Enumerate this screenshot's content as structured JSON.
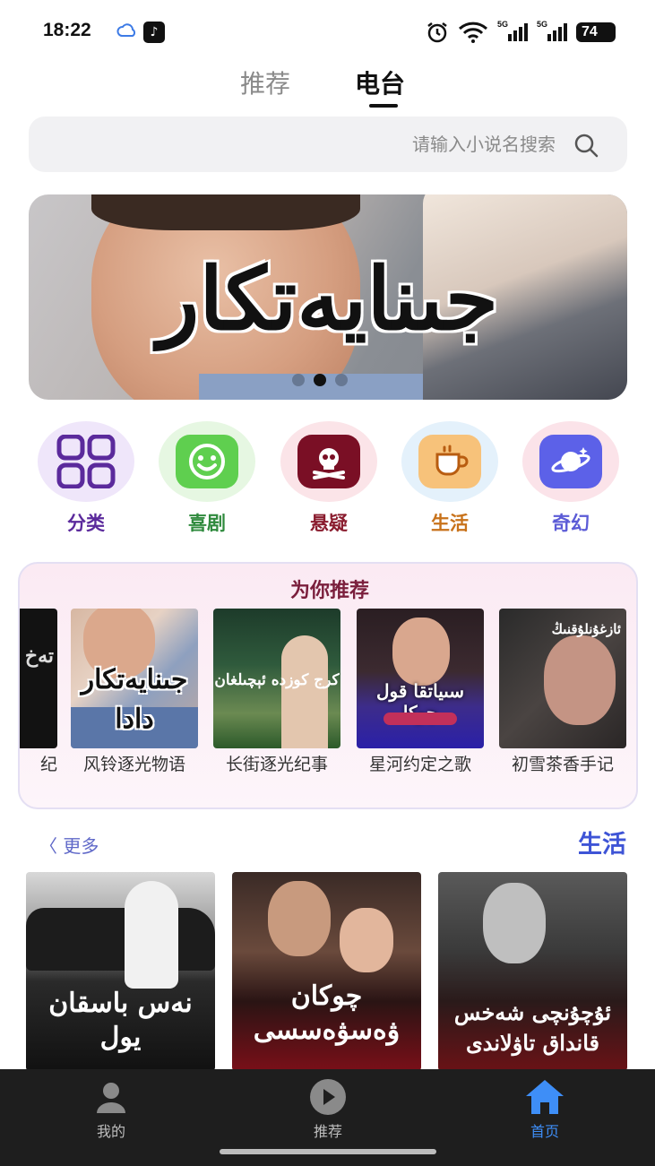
{
  "status_bar": {
    "time": "18:22",
    "battery": "74",
    "signal1": "5G",
    "signal2": "5G"
  },
  "tabs": [
    {
      "label": "推荐",
      "active": false
    },
    {
      "label": "电台",
      "active": true
    }
  ],
  "search": {
    "placeholder": "请输入小说名搜索"
  },
  "banner": {
    "title": "جىنايەتكار",
    "dots": 3,
    "active_dot": 2
  },
  "categories": [
    {
      "label": "分类",
      "icon": "grid-icon",
      "color": "#5b2a9c"
    },
    {
      "label": "喜剧",
      "icon": "smile-icon",
      "color": "#2f8a3d"
    },
    {
      "label": "悬疑",
      "icon": "skull-icon",
      "color": "#8a1c2e"
    },
    {
      "label": "生活",
      "icon": "coffee-icon",
      "color": "#c8721a"
    },
    {
      "label": "奇幻",
      "icon": "planet-icon",
      "color": "#5b5bd6"
    }
  ],
  "recommend": {
    "title": "为你推荐",
    "items": [
      {
        "label": "纪",
        "cover_text": "تەخ"
      },
      {
        "label": "风铃逐光物语",
        "cover_text": "جىنايەتكار دادا"
      },
      {
        "label": "长街逐光纪事",
        "cover_text": "كرج كوزدە ئېچىلغان"
      },
      {
        "label": "星河约定之歌",
        "cover_text": "سىياتقا قول چوكا"
      },
      {
        "label": "初雪茶香手记",
        "cover_text": "ئازغۇنلۇقنىڭ"
      }
    ]
  },
  "life_section": {
    "more_label": "更多",
    "title": "生活",
    "items": [
      {
        "title": "نەس باسقان يول"
      },
      {
        "title": "چوكان ۋەسۋەسسى"
      },
      {
        "title": "ئۇچۇنچى شەخس قانداق تاۋلاندى"
      }
    ]
  },
  "bottom_nav": [
    {
      "label": "我的",
      "icon": "user-icon",
      "active": false
    },
    {
      "label": "推荐",
      "icon": "play-icon",
      "active": false
    },
    {
      "label": "首页",
      "icon": "home-icon",
      "active": true
    }
  ]
}
